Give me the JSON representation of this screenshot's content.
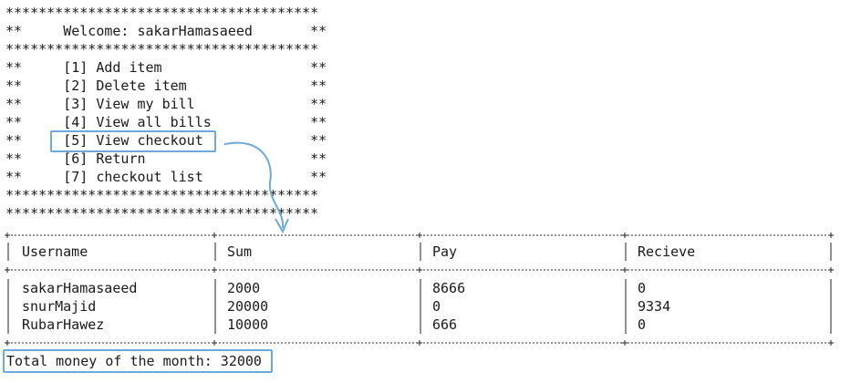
{
  "menu": {
    "border": "**************************************",
    "welcome_line": "**     Welcome: sakarHamasaeed       **",
    "items": [
      "**     [1] Add item                  **",
      "**     [2] Delete item               **",
      "**     [3] View my bill              **",
      "**     [4] View all bills            **",
      "**     [5] View checkout             **",
      "**     [6] Return                    **",
      "**     [7] checkout list             **"
    ]
  },
  "table": {
    "headers": [
      "Username",
      "Sum",
      "Pay",
      "Recieve"
    ],
    "rows": [
      [
        "sakarHamasaeed",
        "2000",
        "8666",
        "0"
      ],
      [
        "snurMajid",
        "20000",
        "0",
        "9334"
      ],
      [
        "RubarHawez",
        "10000",
        "666",
        "0"
      ]
    ]
  },
  "total": "Total money of the month: 32000",
  "accent_color": "#6fa8dc"
}
